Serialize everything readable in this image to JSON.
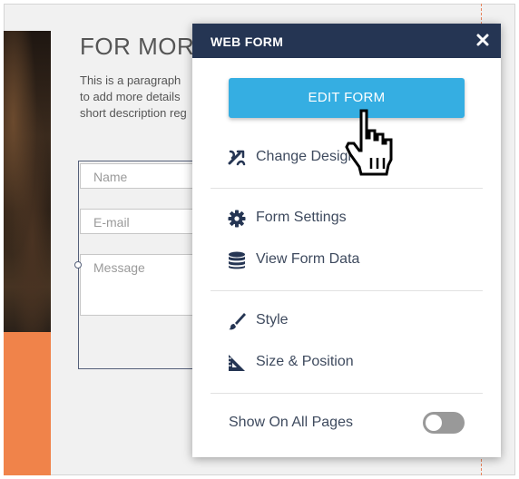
{
  "page": {
    "heading": "FOR MORE",
    "paragraph_lines": [
      "This is a paragraph",
      "to add more details",
      "short description reg"
    ],
    "form_fields": {
      "name_placeholder": "Name",
      "email_placeholder": "E-mail",
      "message_placeholder": "Message"
    }
  },
  "popup": {
    "title": "WEB FORM",
    "close_icon": "close-icon",
    "edit_button_label": "EDIT FORM",
    "menu_groups": [
      [
        {
          "label": "Change Design",
          "icon": "design-swap-icon"
        }
      ],
      [
        {
          "label": "Form Settings",
          "icon": "gear-icon"
        },
        {
          "label": "View Form Data",
          "icon": "database-icon"
        }
      ],
      [
        {
          "label": "Style",
          "icon": "brush-icon"
        },
        {
          "label": "Size & Position",
          "icon": "ruler-triangle-icon"
        }
      ]
    ],
    "toggle": {
      "label": "Show On All Pages",
      "on": false
    }
  },
  "colors": {
    "header_bg": "#253553",
    "edit_button": "#35aee2",
    "accent_orange": "#f0834a",
    "menu_text": "#3e4a5e",
    "toggle_off": "#999999"
  },
  "cursor": "hand-pointer-icon"
}
